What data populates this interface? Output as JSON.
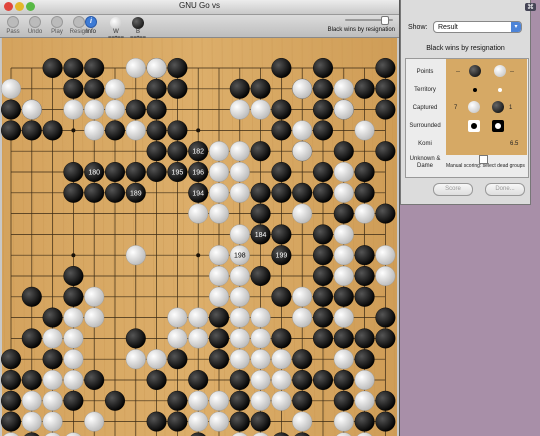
{
  "window": {
    "title": "GNU Go vs"
  },
  "toolbar": {
    "pass_label": "Pass",
    "undo_label": "Undo",
    "play_label": "Play",
    "resign_label": "Resign",
    "info_label": "Info",
    "white_player": "W ==•==",
    "black_player": "B ==•==",
    "result_text": "Black wins by resignation"
  },
  "board": {
    "size": 19,
    "black": [
      [
        0,
        2
      ],
      [
        0,
        3
      ],
      [
        0,
        4
      ],
      [
        0,
        7
      ],
      [
        0,
        8
      ],
      [
        0,
        13
      ],
      [
        0,
        15
      ],
      [
        0,
        18
      ],
      [
        1,
        3
      ],
      [
        1,
        4
      ],
      [
        1,
        7
      ],
      [
        1,
        8
      ],
      [
        1,
        11
      ],
      [
        1,
        12
      ],
      [
        1,
        14
      ],
      [
        1,
        15
      ],
      [
        1,
        17
      ],
      [
        1,
        18
      ],
      [
        2,
        0
      ],
      [
        2,
        1
      ],
      [
        2,
        6
      ],
      [
        2,
        7
      ],
      [
        2,
        13
      ],
      [
        2,
        15
      ],
      [
        2,
        16
      ],
      [
        2,
        18
      ],
      [
        3,
        0
      ],
      [
        3,
        1
      ],
      [
        3,
        2
      ],
      [
        3,
        5
      ],
      [
        3,
        7
      ],
      [
        3,
        8
      ],
      [
        3,
        13
      ],
      [
        3,
        15
      ],
      [
        4,
        7
      ],
      [
        4,
        8
      ],
      [
        4,
        9
      ],
      [
        4,
        12
      ],
      [
        4,
        14
      ],
      [
        4,
        16
      ],
      [
        4,
        18
      ],
      [
        5,
        3
      ],
      [
        5,
        4
      ],
      [
        5,
        5
      ],
      [
        5,
        6
      ],
      [
        5,
        7
      ],
      [
        5,
        8
      ],
      [
        5,
        9
      ],
      [
        5,
        13
      ],
      [
        5,
        15
      ],
      [
        5,
        17
      ],
      [
        6,
        3
      ],
      [
        6,
        4
      ],
      [
        6,
        5
      ],
      [
        6,
        6
      ],
      [
        6,
        9
      ],
      [
        6,
        12
      ],
      [
        6,
        13
      ],
      [
        6,
        14
      ],
      [
        6,
        15
      ],
      [
        6,
        17
      ],
      [
        7,
        12
      ],
      [
        7,
        16
      ],
      [
        7,
        18
      ],
      [
        8,
        12
      ],
      [
        8,
        13
      ],
      [
        8,
        15
      ],
      [
        9,
        13
      ],
      [
        9,
        15
      ],
      [
        9,
        17
      ],
      [
        10,
        3
      ],
      [
        10,
        12
      ],
      [
        10,
        15
      ],
      [
        10,
        17
      ],
      [
        11,
        1
      ],
      [
        11,
        3
      ],
      [
        11,
        13
      ],
      [
        11,
        15
      ],
      [
        11,
        16
      ],
      [
        11,
        17
      ],
      [
        12,
        2
      ],
      [
        12,
        10
      ],
      [
        12,
        15
      ],
      [
        12,
        18
      ],
      [
        13,
        1
      ],
      [
        13,
        6
      ],
      [
        13,
        10
      ],
      [
        13,
        13
      ],
      [
        13,
        15
      ],
      [
        13,
        16
      ],
      [
        13,
        17
      ],
      [
        13,
        18
      ],
      [
        14,
        0
      ],
      [
        14,
        2
      ],
      [
        14,
        8
      ],
      [
        14,
        10
      ],
      [
        14,
        14
      ],
      [
        14,
        17
      ],
      [
        15,
        0
      ],
      [
        15,
        1
      ],
      [
        15,
        4
      ],
      [
        15,
        7
      ],
      [
        15,
        9
      ],
      [
        15,
        11
      ],
      [
        15,
        14
      ],
      [
        15,
        15
      ],
      [
        15,
        16
      ],
      [
        16,
        0
      ],
      [
        16,
        3
      ],
      [
        16,
        5
      ],
      [
        16,
        8
      ],
      [
        16,
        11
      ],
      [
        16,
        14
      ],
      [
        16,
        16
      ],
      [
        16,
        18
      ],
      [
        17,
        0
      ],
      [
        17,
        7
      ],
      [
        17,
        8
      ],
      [
        17,
        11
      ],
      [
        17,
        12
      ],
      [
        17,
        17
      ],
      [
        17,
        18
      ],
      [
        18,
        1
      ],
      [
        18,
        9
      ],
      [
        18,
        13
      ],
      [
        18,
        14
      ]
    ],
    "white": [
      [
        0,
        6
      ],
      [
        0,
        7
      ],
      [
        1,
        0
      ],
      [
        1,
        5
      ],
      [
        1,
        14
      ],
      [
        1,
        16
      ],
      [
        2,
        1
      ],
      [
        2,
        3
      ],
      [
        2,
        4
      ],
      [
        2,
        5
      ],
      [
        2,
        11
      ],
      [
        2,
        12
      ],
      [
        2,
        16
      ],
      [
        3,
        4
      ],
      [
        3,
        6
      ],
      [
        3,
        14
      ],
      [
        3,
        17
      ],
      [
        4,
        10
      ],
      [
        4,
        11
      ],
      [
        4,
        14
      ],
      [
        5,
        11
      ],
      [
        5,
        10
      ],
      [
        5,
        16
      ],
      [
        6,
        10
      ],
      [
        6,
        11
      ],
      [
        6,
        16
      ],
      [
        7,
        9
      ],
      [
        7,
        10
      ],
      [
        7,
        14
      ],
      [
        7,
        17
      ],
      [
        8,
        11
      ],
      [
        8,
        16
      ],
      [
        9,
        6
      ],
      [
        9,
        10
      ],
      [
        9,
        11
      ],
      [
        9,
        16
      ],
      [
        9,
        18
      ],
      [
        10,
        10
      ],
      [
        10,
        11
      ],
      [
        10,
        16
      ],
      [
        10,
        18
      ],
      [
        11,
        4
      ],
      [
        11,
        10
      ],
      [
        11,
        11
      ],
      [
        11,
        14
      ],
      [
        12,
        3
      ],
      [
        12,
        4
      ],
      [
        12,
        8
      ],
      [
        12,
        9
      ],
      [
        12,
        11
      ],
      [
        12,
        12
      ],
      [
        12,
        14
      ],
      [
        12,
        16
      ],
      [
        13,
        2
      ],
      [
        13,
        3
      ],
      [
        13,
        8
      ],
      [
        13,
        9
      ],
      [
        13,
        11
      ],
      [
        13,
        12
      ],
      [
        14,
        3
      ],
      [
        14,
        6
      ],
      [
        14,
        7
      ],
      [
        14,
        11
      ],
      [
        14,
        12
      ],
      [
        14,
        13
      ],
      [
        14,
        16
      ],
      [
        15,
        2
      ],
      [
        15,
        3
      ],
      [
        15,
        12
      ],
      [
        15,
        13
      ],
      [
        15,
        17
      ],
      [
        16,
        1
      ],
      [
        16,
        2
      ],
      [
        16,
        9
      ],
      [
        16,
        10
      ],
      [
        16,
        12
      ],
      [
        16,
        13
      ],
      [
        16,
        17
      ],
      [
        17,
        1
      ],
      [
        17,
        2
      ],
      [
        17,
        4
      ],
      [
        17,
        9
      ],
      [
        17,
        10
      ],
      [
        17,
        14
      ],
      [
        17,
        16
      ],
      [
        18,
        0
      ],
      [
        18,
        2
      ],
      [
        18,
        3
      ],
      [
        18,
        11
      ],
      [
        18,
        12
      ],
      [
        18,
        16
      ],
      [
        18,
        17
      ]
    ],
    "labels": [
      {
        "r": 3,
        "c": 9,
        "t": "183"
      },
      {
        "r": 4,
        "c": 4,
        "t": "190"
      },
      {
        "r": 4,
        "c": 9,
        "t": "182"
      },
      {
        "r": 5,
        "c": 4,
        "t": "180"
      },
      {
        "r": 5,
        "c": 8,
        "t": "195"
      },
      {
        "r": 5,
        "c": 9,
        "t": "196"
      },
      {
        "r": 6,
        "c": 6,
        "t": "189"
      },
      {
        "r": 6,
        "c": 7,
        "t": "191"
      },
      {
        "r": 6,
        "c": 8,
        "t": "193"
      },
      {
        "r": 6,
        "c": 9,
        "t": "194"
      },
      {
        "r": 7,
        "c": 3,
        "t": "181"
      },
      {
        "r": 7,
        "c": 6,
        "t": "187"
      },
      {
        "r": 7,
        "c": 8,
        "t": "197"
      },
      {
        "r": 8,
        "c": 7,
        "t": "192"
      },
      {
        "r": 8,
        "c": 12,
        "t": "184"
      },
      {
        "r": 9,
        "c": 5,
        "t": "188"
      },
      {
        "r": 9,
        "c": 11,
        "t": "198"
      },
      {
        "r": 9,
        "c": 13,
        "t": "199"
      },
      {
        "r": 10,
        "c": 13,
        "t": "185"
      },
      {
        "r": 11,
        "c": 12,
        "t": "186"
      }
    ]
  },
  "panel": {
    "show_label": "Show:",
    "show_value": "Result",
    "result_title": "Black wins by resignation",
    "rows": [
      {
        "label": "Points"
      },
      {
        "label": "Territory"
      },
      {
        "label": "Captured"
      },
      {
        "label": "Surrounded"
      },
      {
        "label": "Komi"
      },
      {
        "label": "Unknown & Dame"
      }
    ],
    "points_black": "--",
    "points_white": "--",
    "captured_black": "7",
    "captured_white": "1",
    "komi_value": "6.5",
    "manual_scoring_label": "Manual scoring: select dead groups",
    "score_button": "Score",
    "done_button": "Done..."
  }
}
